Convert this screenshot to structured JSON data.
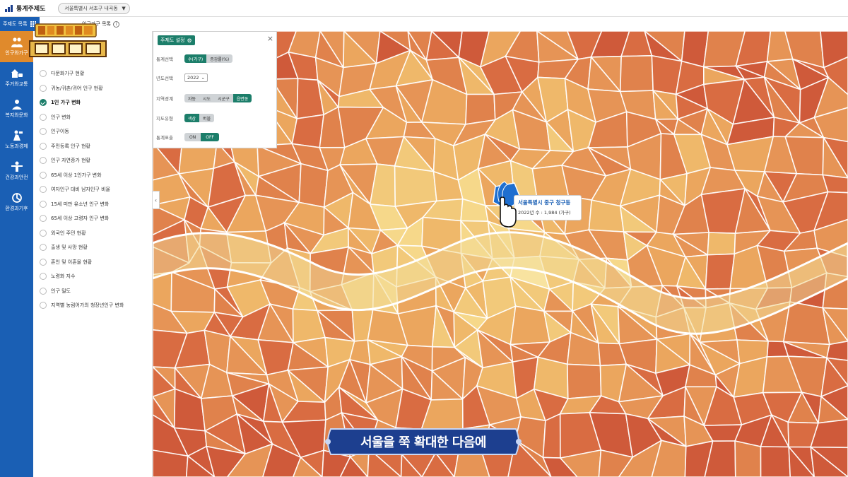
{
  "app": {
    "title": "통계주제도",
    "region_select": "서울특별시 서초구 내곡동"
  },
  "subbar": {
    "theme_list_label": "주제도 목록",
    "subtitle": "인구가구 목록"
  },
  "sidebar": {
    "categories": [
      {
        "label": "인구와가구",
        "icon": "people-icon",
        "active": true
      },
      {
        "label": "주거와교통",
        "icon": "bus-house-icon",
        "active": false
      },
      {
        "label": "복지와문화",
        "icon": "care-icon",
        "active": false
      },
      {
        "label": "노동과경제",
        "icon": "worker-icon",
        "active": false
      },
      {
        "label": "건강과안전",
        "icon": "fitness-icon",
        "active": false
      },
      {
        "label": "환경과기후",
        "icon": "environment-icon",
        "active": false
      }
    ]
  },
  "theme_list": {
    "items": [
      {
        "label": "다문화가구 현황",
        "selected": false
      },
      {
        "label": "귀농/귀촌/귀어 인구 현황",
        "selected": false
      },
      {
        "label": "1인 가구 변화",
        "selected": true
      },
      {
        "label": "인구 변화",
        "selected": false
      },
      {
        "label": "인구이동",
        "selected": false
      },
      {
        "label": "주민등록 인구 현황",
        "selected": false
      },
      {
        "label": "인구 자연증가 현황",
        "selected": false
      },
      {
        "label": "65세 이상 1인가구 변화",
        "selected": false
      },
      {
        "label": "여자인구 대비 남자인구 비율",
        "selected": false
      },
      {
        "label": "15세 미만 유소년 인구 변화",
        "selected": false
      },
      {
        "label": "65세 이상 고령자 인구 변화",
        "selected": false
      },
      {
        "label": "외국인 주민 현황",
        "selected": false
      },
      {
        "label": "출생 및 사망 현황",
        "selected": false
      },
      {
        "label": "혼인 및 이혼율 현황",
        "selected": false
      },
      {
        "label": "노령화 지수",
        "selected": false
      },
      {
        "label": "인구 밀도",
        "selected": false
      },
      {
        "label": "지역별 농림어가의 청장년인구 변화",
        "selected": false
      }
    ]
  },
  "settings": {
    "title": "주제도 설정",
    "close": "×",
    "rows": {
      "stat_select": {
        "label": "통계선택",
        "options": [
          "수(가구)",
          "증감률(%)"
        ],
        "active": 0
      },
      "year_select": {
        "label": "년도선택",
        "value": "2022"
      },
      "boundary": {
        "label": "지역경계",
        "options": [
          "자동",
          "시도",
          "시군구",
          "읍면동"
        ],
        "active": 3
      },
      "map_type": {
        "label": "지도유형",
        "options": [
          "색상",
          "버블"
        ],
        "active": 0
      },
      "stat_display": {
        "label": "통계표출",
        "options": [
          "ON",
          "OFF"
        ],
        "active": 1
      }
    }
  },
  "tooltip": {
    "title": "서울특별시 중구 청구동",
    "value": "2022년 수 : 1,984 (가구)"
  },
  "caption": "서울을 쭉 확대한 다음에",
  "colors": {
    "sidebar_blue": "#1a5fb4",
    "active_orange": "#e08a2c",
    "panel_green": "#1c7e6a",
    "map_light": "#f7d98a",
    "map_mid": "#eca55f",
    "map_dark": "#d4583a"
  }
}
